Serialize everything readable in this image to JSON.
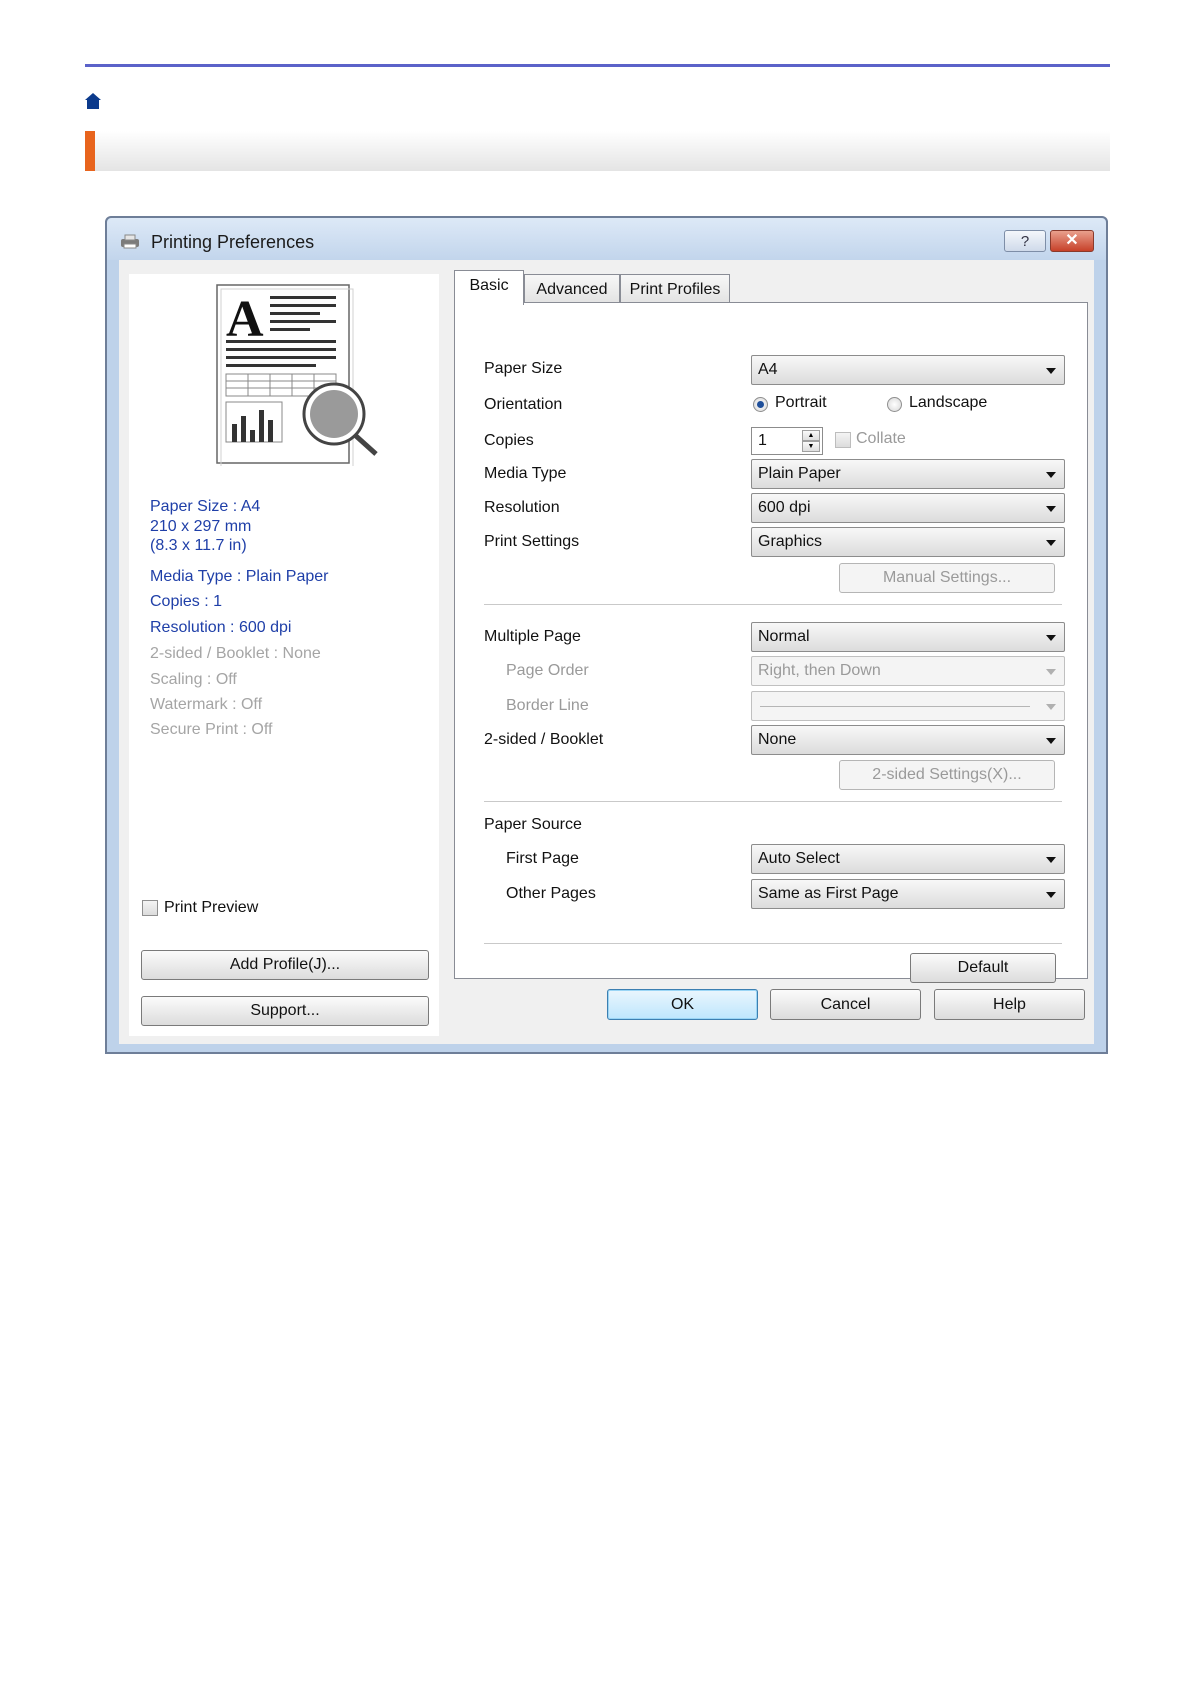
{
  "window": {
    "title": "Printing Preferences",
    "help_button": "?",
    "close_button": "✕"
  },
  "summary": {
    "paper_size": "Paper Size : A4",
    "dimensions_mm": "210 x 297 mm",
    "dimensions_in": "(8.3 x 11.7 in)",
    "media_type": "Media Type : Plain Paper",
    "copies": "Copies : 1",
    "resolution": "Resolution : 600 dpi",
    "two_sided": "2-sided / Booklet : None",
    "scaling": "Scaling : Off",
    "watermark": "Watermark : Off",
    "secure_print": "Secure Print : Off"
  },
  "left": {
    "print_preview_label": "Print Preview",
    "add_profile_button": "Add Profile(J)...",
    "support_button": "Support..."
  },
  "tabs": [
    {
      "label": "Basic",
      "active": true
    },
    {
      "label": "Advanced",
      "active": false
    },
    {
      "label": "Print Profiles",
      "active": false
    }
  ],
  "basic": {
    "paper_size": {
      "label": "Paper Size",
      "value": "A4"
    },
    "orientation": {
      "label": "Orientation",
      "portrait": "Portrait",
      "landscape": "Landscape",
      "selected": "Portrait"
    },
    "copies": {
      "label": "Copies",
      "value": "1",
      "collate": "Collate"
    },
    "media_type": {
      "label": "Media Type",
      "value": "Plain Paper"
    },
    "resolution": {
      "label": "Resolution",
      "value": "600 dpi"
    },
    "print_settings": {
      "label": "Print Settings",
      "value": "Graphics"
    },
    "manual_settings_button": "Manual Settings...",
    "multiple_page": {
      "label": "Multiple Page",
      "value": "Normal"
    },
    "page_order": {
      "label": "Page Order",
      "value": "Right, then Down"
    },
    "border_line": {
      "label": "Border Line",
      "value": ""
    },
    "two_sided": {
      "label": "2-sided / Booklet",
      "value": "None"
    },
    "two_sided_settings_button": "2-sided Settings(X)...",
    "paper_source": {
      "label": "Paper Source"
    },
    "first_page": {
      "label": "First Page",
      "value": "Auto Select"
    },
    "other_pages": {
      "label": "Other Pages",
      "value": "Same as First Page"
    },
    "default_button": "Default"
  },
  "footer": {
    "ok": "OK",
    "cancel": "Cancel",
    "help": "Help"
  },
  "colors": {
    "accent_orange": "#e8641d",
    "top_rule": "#5b62c9",
    "summary_blue": "#1f3fa8"
  }
}
